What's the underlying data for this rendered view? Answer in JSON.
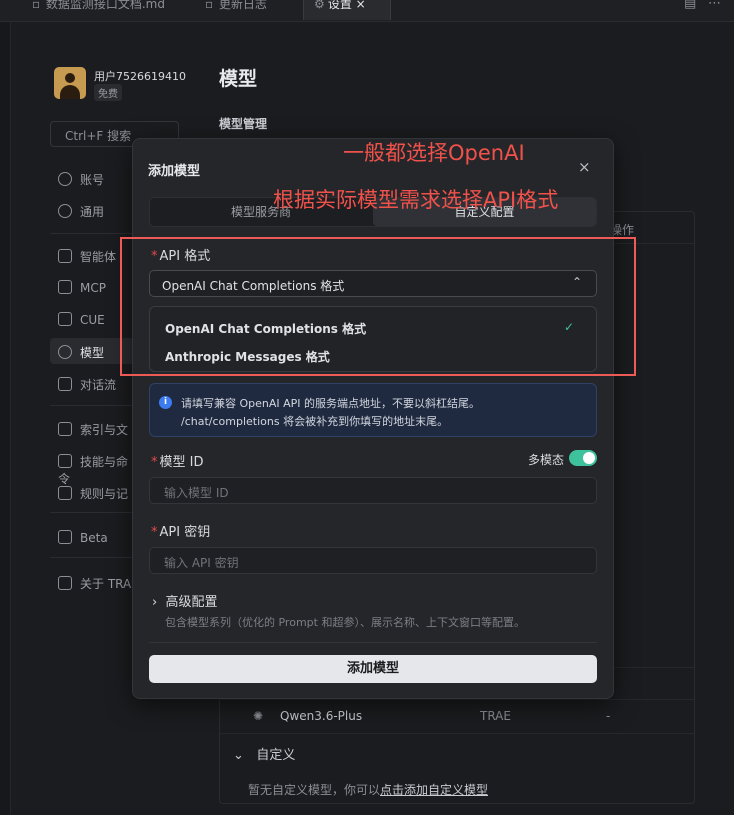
{
  "tabs": [
    {
      "label": "数据监测接口文档.md",
      "icon": "file-icon"
    },
    {
      "label": "更新日志",
      "icon": "file-icon"
    },
    {
      "label": "设置",
      "icon": "gear-icon",
      "close": "×"
    }
  ],
  "user": {
    "name": "用户7526619410",
    "plan": "免费"
  },
  "search": {
    "placeholder": "Ctrl+F 搜索"
  },
  "nav": [
    {
      "label": "账号"
    },
    {
      "label": "通用"
    },
    {
      "label": "智能体"
    },
    {
      "label": "MCP"
    },
    {
      "label": "CUE"
    },
    {
      "label": "模型"
    },
    {
      "label": "对话流"
    },
    {
      "label": "索引与文"
    },
    {
      "label": "技能与命令"
    },
    {
      "label": "规则与记"
    },
    {
      "label": "Beta"
    },
    {
      "label": "关于 TRA"
    }
  ],
  "page": {
    "title": "模型",
    "section": "模型管理",
    "op_col": "操作"
  },
  "model_row": {
    "name": "Qwen3.6-Plus",
    "provider": "TRAE",
    "op": "-"
  },
  "custom": {
    "header": "自定义",
    "empty_prefix": "暂无自定义模型，你可以",
    "empty_link": "点击添加自定义模型"
  },
  "modal": {
    "title": "添加模型",
    "close": "×",
    "tabs": [
      "模型服务商",
      "自定义配置"
    ],
    "api_format_label": "API 格式",
    "required_mark": "*",
    "api_format_value": "OpenAI Chat Completions 格式",
    "options": [
      {
        "label": "OpenAI Chat Completions 格式",
        "selected": true
      },
      {
        "label": "Anthropic Messages 格式",
        "selected": false
      }
    ],
    "check_mark": "✓",
    "info_line1": "请填写兼容 OpenAI API 的服务端点地址，不要以斜杠结尾。",
    "info_line2": "/chat/completions 将会被补充到你填写的地址末尾。",
    "info_icon": "i",
    "model_id_label": "模型 ID",
    "multimodal_label": "多模态",
    "multimodal_on": true,
    "model_id_placeholder": "输入模型 ID",
    "api_key_label": "API 密钥",
    "api_key_placeholder": "输入 API 密钥",
    "advanced_label": "高级配置",
    "advanced_desc": "包含模型系列（优化的 Prompt 和超参）、展示名称、上下文窗口等配置。",
    "submit_label": "添加模型"
  },
  "annotations": {
    "line1": "一般都选择OpenAI",
    "line2": "根据实际模型需求选择API格式",
    "color": "#f0524b"
  }
}
